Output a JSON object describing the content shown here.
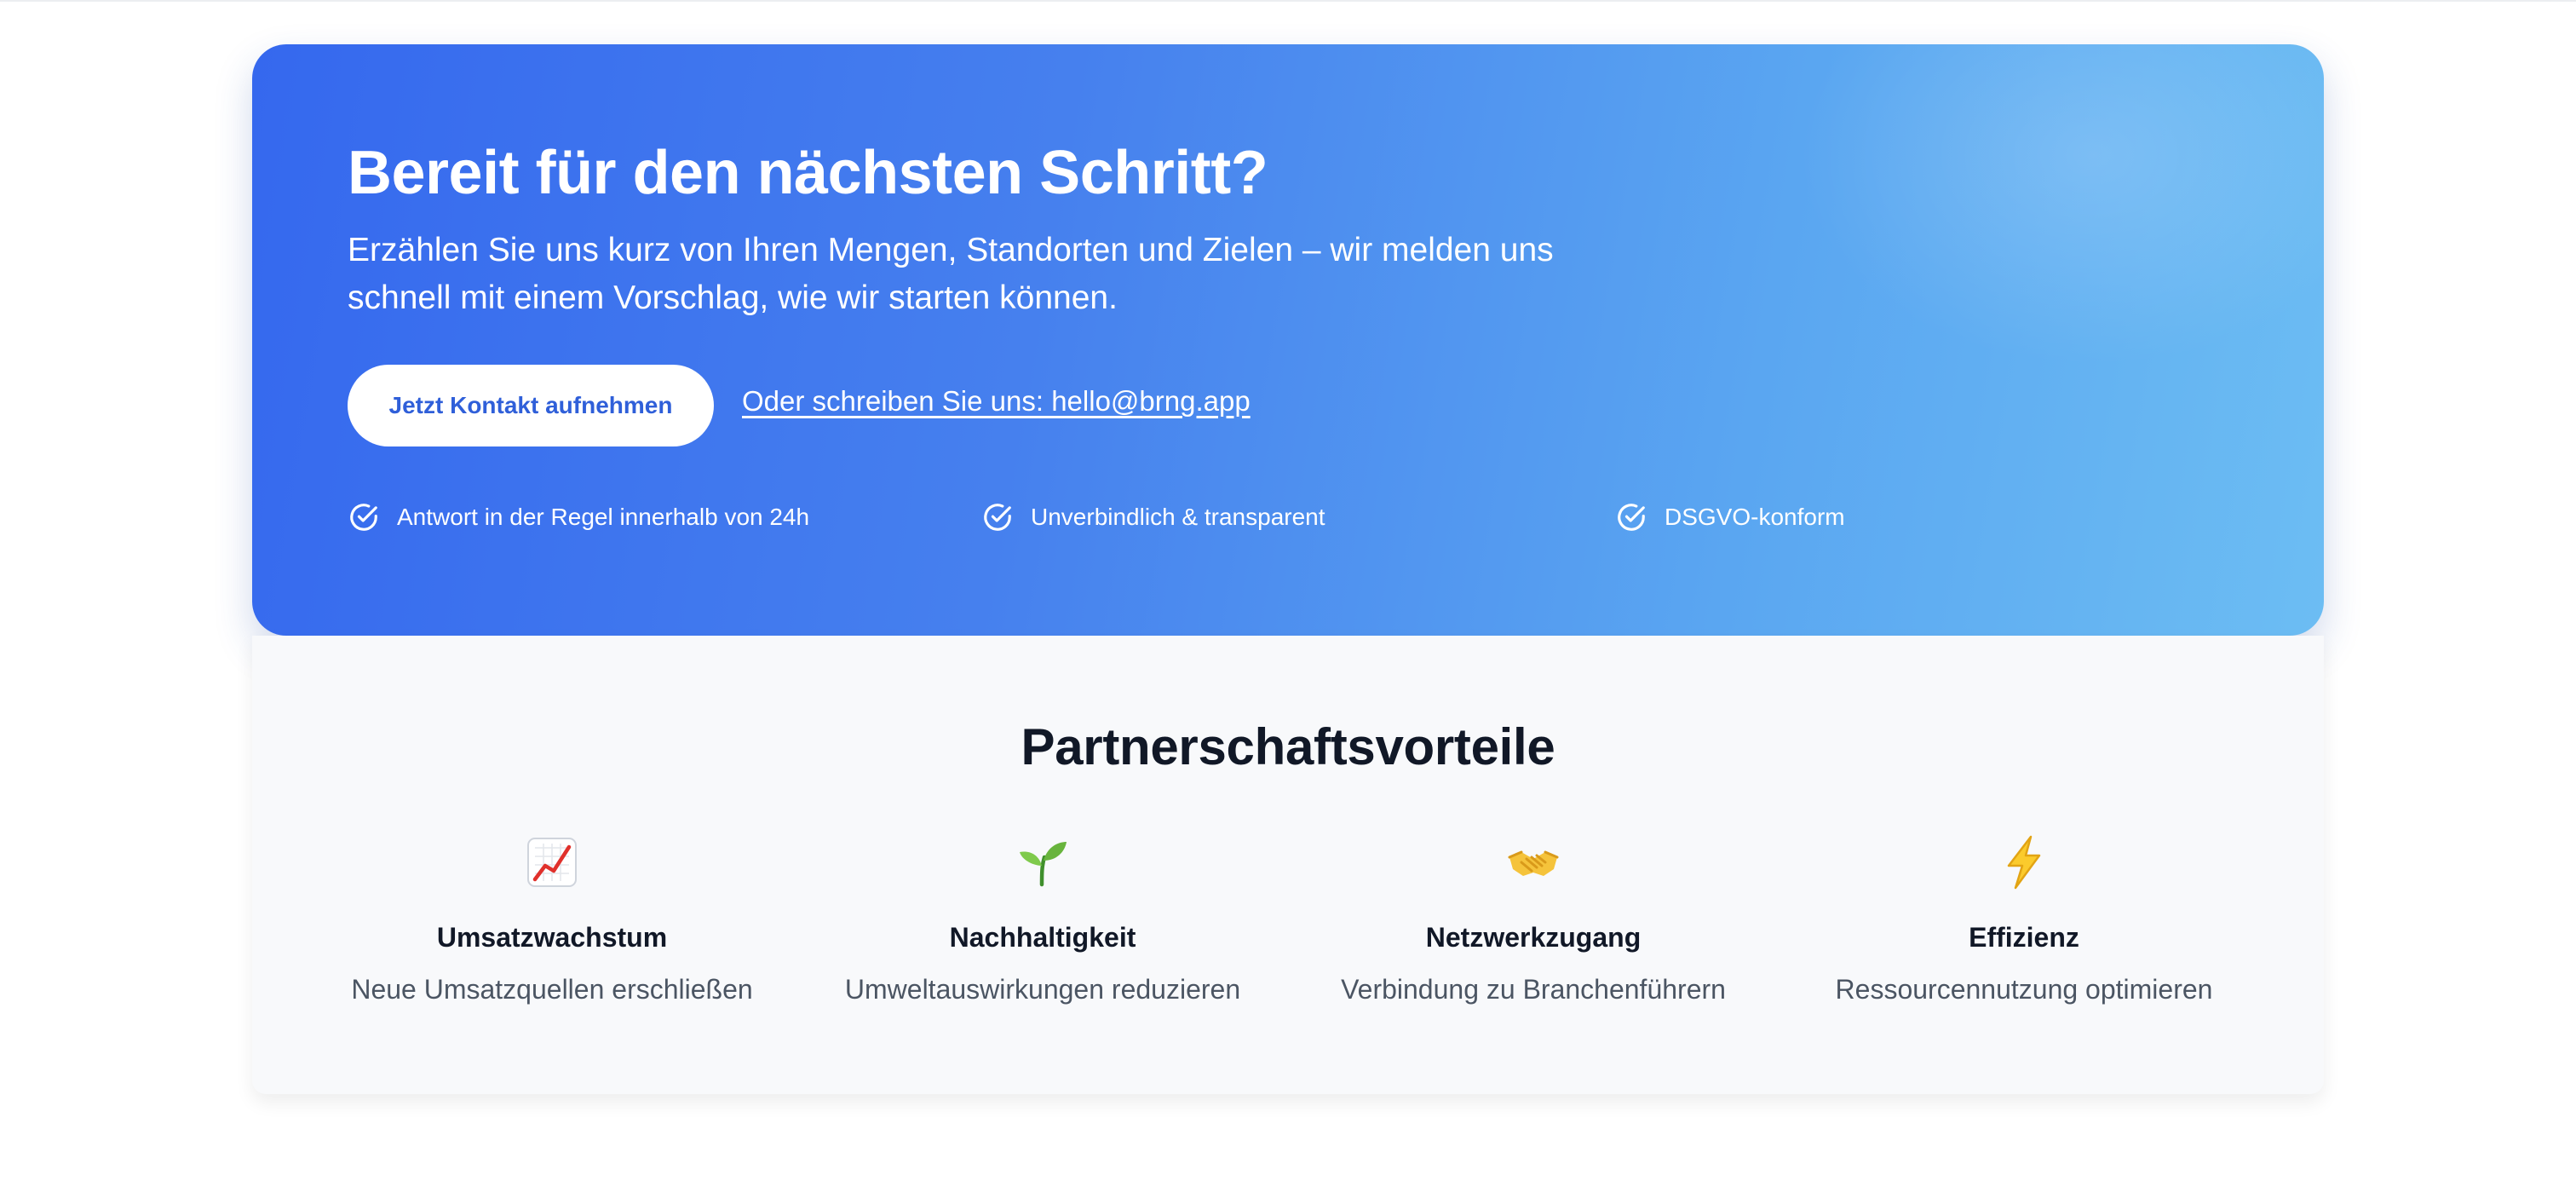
{
  "cta": {
    "title": "Bereit für den nächsten Schritt?",
    "subtitle": "Erzählen Sie uns kurz von Ihren Mengen, Standorten und Zielen – wir melden uns schnell mit einem Vorschlag, wie wir starten können.",
    "button_label": "Jetzt Kontakt aufnehmen",
    "email_link": "Oder schreiben Sie uns: hello@brng.app",
    "features": [
      {
        "icon": "check-circle-icon",
        "label": "Antwort in der Regel innerhalb von 24h"
      },
      {
        "icon": "check-circle-icon",
        "label": "Unverbindlich & transparent"
      },
      {
        "icon": "check-circle-icon",
        "label": "DSGVO-konform"
      }
    ],
    "colors": {
      "gradient_start": "#3568ee",
      "gradient_end": "#6cbdf3",
      "button_text": "#2f5fd9"
    }
  },
  "benefits": {
    "title": "Partnerschaftsvorteile",
    "items": [
      {
        "icon": "chart-increasing-icon",
        "title": "Umsatzwachstum",
        "description": "Neue Umsatzquellen erschließen"
      },
      {
        "icon": "seedling-icon",
        "title": "Nachhaltigkeit",
        "description": "Umweltauswirkungen reduzieren"
      },
      {
        "icon": "handshake-icon",
        "title": "Netzwerkzugang",
        "description": "Verbindung zu Branchenführern"
      },
      {
        "icon": "lightning-icon",
        "title": "Effizienz",
        "description": "Ressourcennutzung optimieren"
      }
    ]
  }
}
